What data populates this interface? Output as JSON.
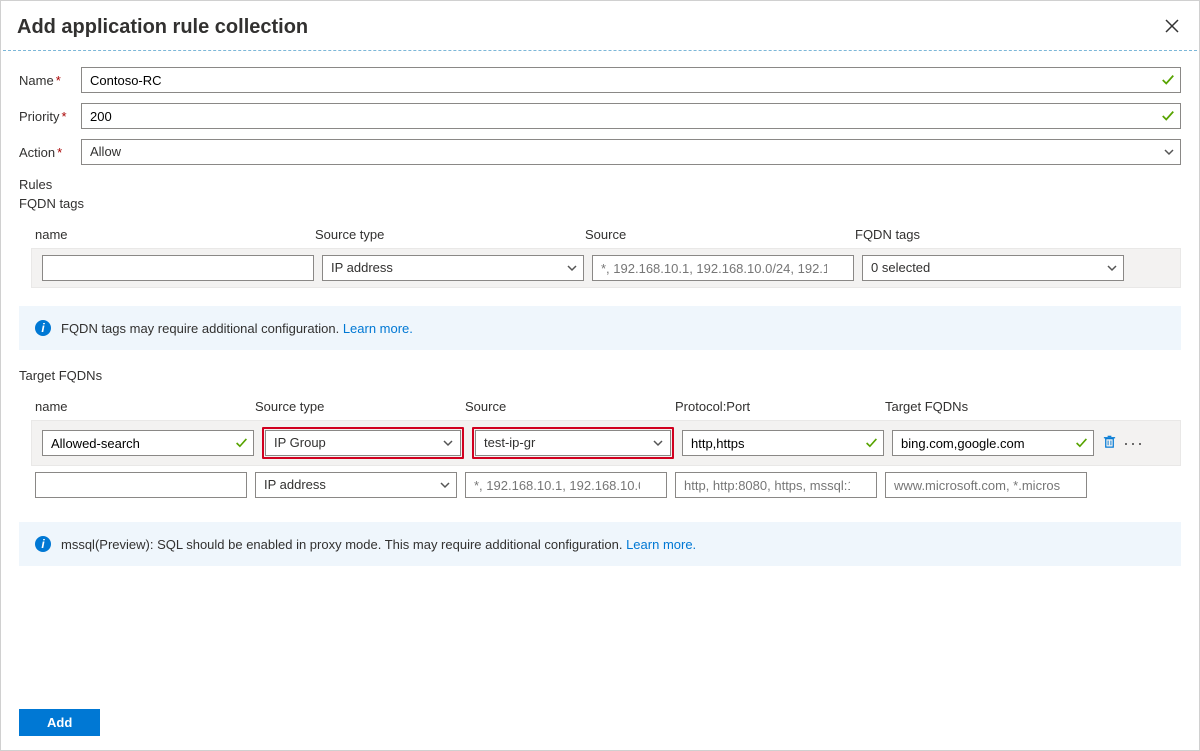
{
  "header": {
    "title": "Add application rule collection"
  },
  "form": {
    "name_label": "Name",
    "name_value": "Contoso-RC",
    "priority_label": "Priority",
    "priority_value": "200",
    "action_label": "Action",
    "action_value": "Allow"
  },
  "sections": {
    "rules": "Rules",
    "fqdn_tags": "FQDN tags",
    "target_fqdns": "Target FQDNs"
  },
  "fqdn_table": {
    "headers": {
      "name": "name",
      "source_type": "Source type",
      "source": "Source",
      "fqdn_tags": "FQDN tags"
    },
    "row": {
      "name": "",
      "source_type": "IP address",
      "source_placeholder": "*, 192.168.10.1, 192.168.10.0/24, 192.1…",
      "fqdn_tags": "0 selected"
    }
  },
  "fqdn_info": {
    "text": "FQDN tags may require additional configuration. ",
    "link": "Learn more."
  },
  "target_table": {
    "headers": {
      "name": "name",
      "source_type": "Source type",
      "source": "Source",
      "protocol": "Protocol:Port",
      "target_fqdns": "Target FQDNs"
    },
    "rows": [
      {
        "name": "Allowed-search",
        "source_type": "IP Group",
        "source": "test-ip-gr",
        "protocol": "http,https",
        "target_fqdns": "bing.com,google.com",
        "has_actions": true,
        "highlight": true,
        "validated": true
      },
      {
        "name": "",
        "source_type": "IP address",
        "source_placeholder": "*, 192.168.10.1, 192.168.10.0/…",
        "protocol_placeholder": "http, http:8080, https, mssql:1…",
        "target_placeholder": "www.microsoft.com, *.micros…",
        "has_actions": false,
        "highlight": false
      }
    ]
  },
  "target_info": {
    "text": "mssql(Preview): SQL should be enabled in proxy mode. This may require additional configuration. ",
    "link": "Learn more."
  },
  "footer": {
    "add": "Add"
  }
}
